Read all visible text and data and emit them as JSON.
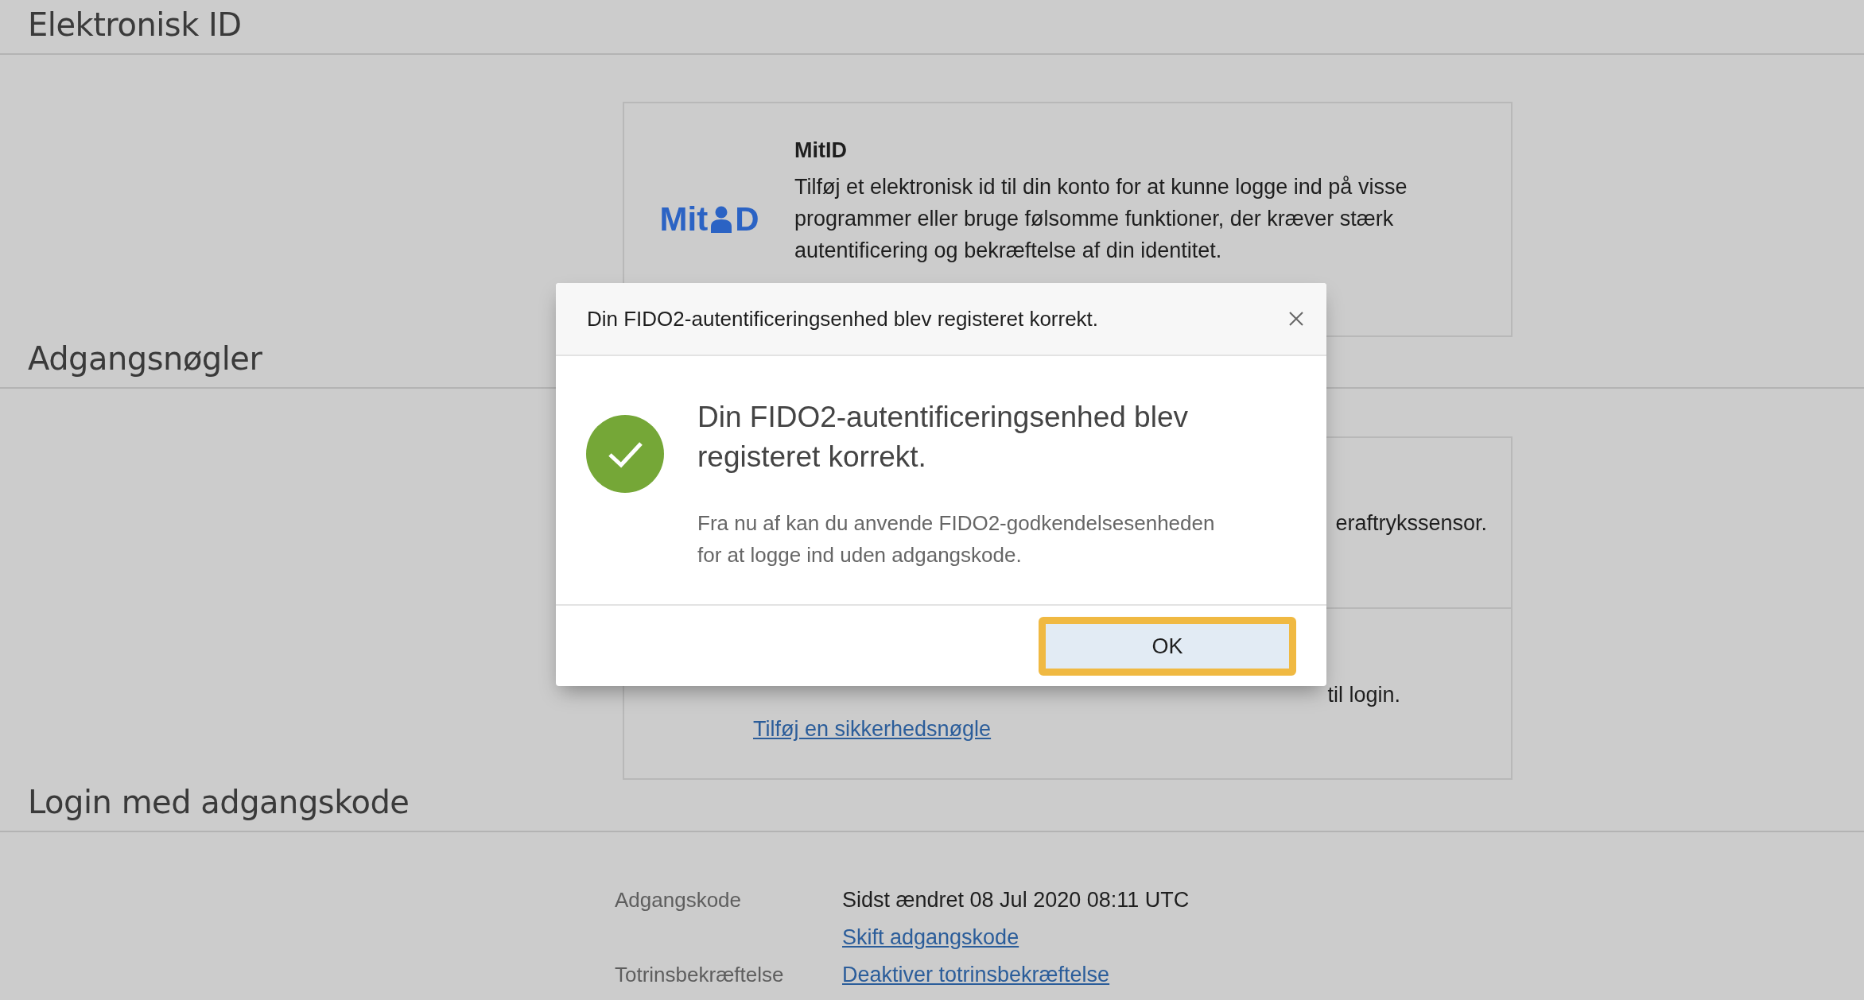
{
  "sections": [
    {
      "title": "Elektronisk ID",
      "card": {
        "logo": {
          "prefix": "Mit",
          "suffix": "D"
        },
        "heading": "MitID",
        "text": "Tilføj et elektronisk id til din konto for at kunne logge ind på visse programmer eller bruge følsomme funktioner, der kræver stærk autentificering og bekræftelse af din identitet."
      }
    },
    {
      "title": "Adgangsnøgler",
      "cards": [
        {
          "text_fragment": "eraftrykssensor."
        },
        {
          "text_fragment": "til login.",
          "link": "Tilføj en sikkerhedsnøgle"
        }
      ]
    },
    {
      "title": "Login med adgangskode",
      "rows": [
        {
          "label": "Adgangskode",
          "value": "Sidst ændret 08 Jul 2020 08:11 UTC",
          "link": "Skift adgangskode"
        },
        {
          "label": "Totrinsbekræftelse",
          "link": "Deaktiver totrinsbekræftelse"
        }
      ]
    }
  ],
  "dialog": {
    "title": "Din FIDO2-autentificeringsenhed blev registeret korrekt.",
    "heading": "Din FIDO2-autentificeringsenhed blev registeret korrekt.",
    "message": "Fra nu af kan du anvende FIDO2-godkendelsesenheden for at logge ind uden adgangskode.",
    "button": {
      "label": "OK",
      "focused": true
    }
  }
}
